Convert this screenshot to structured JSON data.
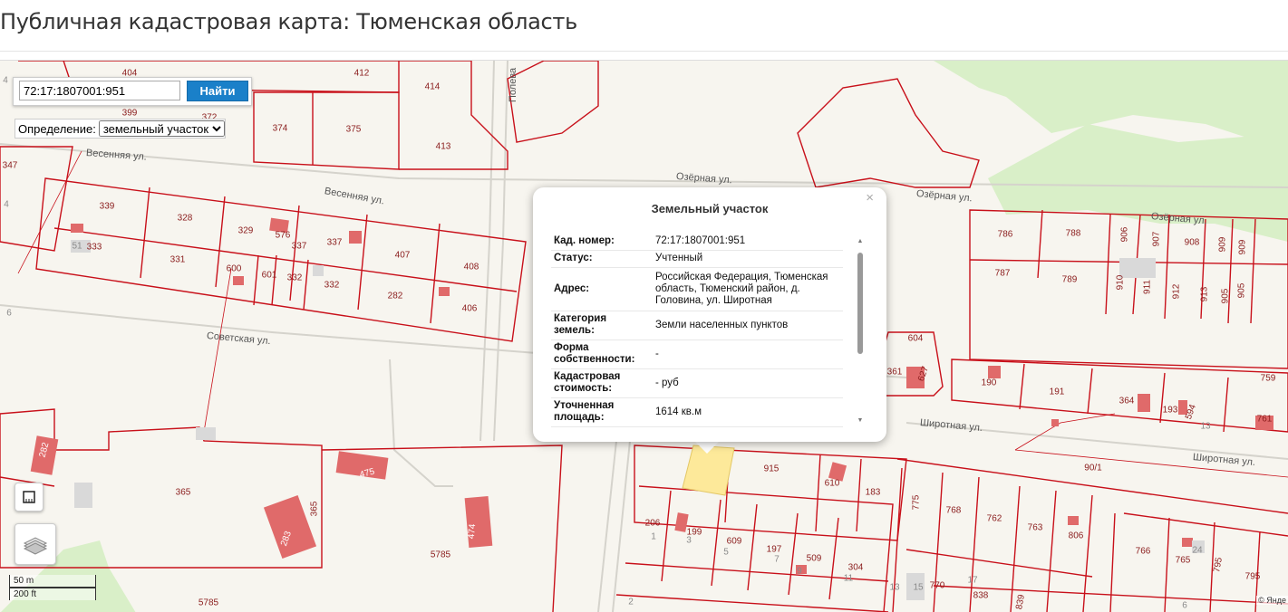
{
  "page": {
    "title": "Публичная кадастровая карта: Тюменская область"
  },
  "search": {
    "value": "72:17:1807001:951",
    "button_label": "Найти"
  },
  "definition": {
    "label": "Определение:",
    "selected": "земельный участок"
  },
  "scale": {
    "metric": "50 m",
    "imperial": "200 ft"
  },
  "copyright": "© Янде",
  "popup": {
    "title": "Земельный участок",
    "close": "×",
    "rows": [
      {
        "key": "Кад. номер:",
        "value": "72:17:1807001:951"
      },
      {
        "key": "Статус:",
        "value": "Учтенный"
      },
      {
        "key": "Адрес:",
        "value": "Российская Федерация, Тюменская область, Тюменский район, д. Головина, ул. Широтная"
      },
      {
        "key": "Категория земель:",
        "value": "Земли населенных пунктов"
      },
      {
        "key": "Форма собственности:",
        "value": "-"
      },
      {
        "key": "Кадастровая стоимость:",
        "value": "- руб"
      },
      {
        "key": "Уточненная площадь:",
        "value": "1614 кв.м"
      }
    ],
    "scroll_up": "▲",
    "scroll_down": "▼"
  },
  "streets": [
    "Весенняя ул.",
    "Весенняя ул.",
    "Озёрная ул.",
    "Озёрная ул.",
    "Озёрная ул.",
    "Советская ул.",
    "Широтная ул.",
    "Широтная ул.",
    "Полева"
  ],
  "parcels": [
    "404",
    "412",
    "414",
    "399",
    "372",
    "374",
    "375",
    "413",
    "347",
    "339",
    "328",
    "329",
    "576",
    "337",
    "337",
    "333",
    "51",
    "331",
    "600",
    "601",
    "332",
    "332",
    "407",
    "408",
    "282",
    "406",
    "786",
    "788",
    "906",
    "907",
    "908",
    "909",
    "909",
    "787",
    "789",
    "910",
    "911",
    "912",
    "913",
    "905",
    "905",
    "604",
    "361",
    "627",
    "190",
    "191",
    "364",
    "193",
    "594",
    "759",
    "761",
    "13",
    "90/1",
    "282",
    "365",
    "365",
    "475",
    "283",
    "474",
    "5785",
    "5785",
    "915",
    "610",
    "183",
    "775",
    "768",
    "762",
    "763",
    "806",
    "766",
    "765",
    "795",
    "795",
    "24",
    "206",
    "199",
    "609",
    "197",
    "509",
    "304",
    "770",
    "838",
    "839",
    "1",
    "3",
    "5",
    "7",
    "9",
    "11",
    "13",
    "15",
    "17",
    "2",
    "6",
    "4",
    "6",
    "4"
  ],
  "colors": {
    "parcel_line": "#c8101a",
    "building": "#e06a6a",
    "green": "#d9efc8",
    "selected": "#fde99a",
    "button": "#1a80c9"
  }
}
